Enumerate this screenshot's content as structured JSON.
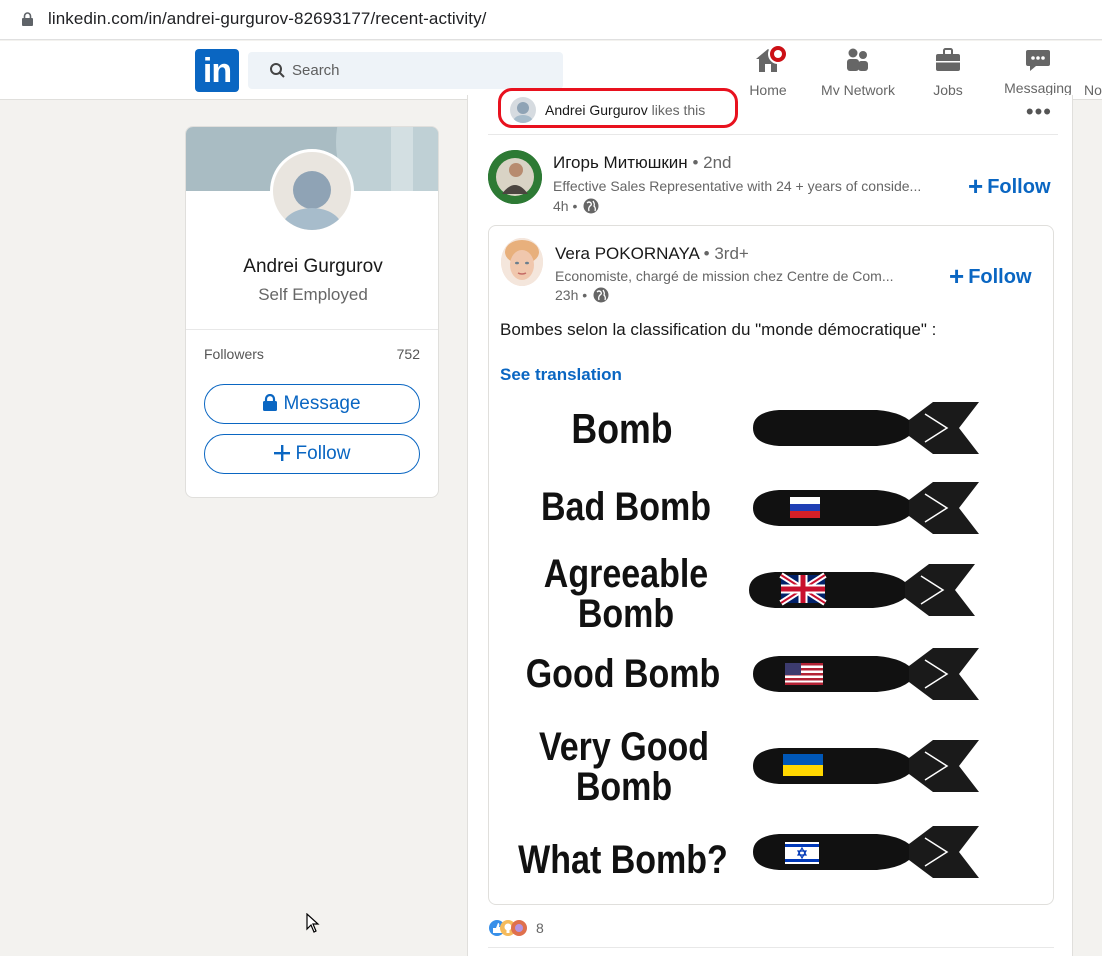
{
  "browser": {
    "url": "linkedin.com/in/andrei-gurgurov-82693177/recent-activity/",
    "icons": [
      "lock-icon"
    ]
  },
  "nav": {
    "logo": "in",
    "search_placeholder": "Search",
    "items": [
      {
        "label": "Home",
        "icon": "home-icon",
        "badge": true
      },
      {
        "label": "My Network",
        "icon": "network-icon"
      },
      {
        "label": "Jobs",
        "icon": "briefcase-icon"
      },
      {
        "label": "Messaging",
        "icon": "messaging-icon"
      },
      {
        "label": "No",
        "icon": "notifications-icon"
      }
    ]
  },
  "profile": {
    "name": "Andrei Gurgurov",
    "title": "Self Employed",
    "followers_label": "Followers",
    "followers_count": "752",
    "message_button": "Message",
    "follow_button": "Follow"
  },
  "feed": {
    "liker_name": "Andrei Gurgurov",
    "liker_suffix": "likes this",
    "more_label": "•••",
    "actor": {
      "name": "Игорь Митюшкин",
      "degree": "• 2nd",
      "headline": "Effective Sales Representative with 24 + years of conside...",
      "time": "4h •",
      "follow": "Follow"
    },
    "shared": {
      "name": "Vera POKORNAYA",
      "degree": "• 3rd+",
      "headline": "Economiste, chargé de mission chez Centre de Com...",
      "time": "23h •",
      "follow": "Follow",
      "text": "Bombes selon la classification du \"monde démocratique\" :",
      "see_translation": "See translation"
    },
    "meme": {
      "rows": [
        {
          "label_line1": "Bomb",
          "label_line2": "",
          "flag": "none"
        },
        {
          "label_line1": "Bad Bomb",
          "label_line2": "",
          "flag": "russia"
        },
        {
          "label_line1": "Agreeable",
          "label_line2": "Bomb",
          "flag": "uk"
        },
        {
          "label_line1": "Good Bomb",
          "label_line2": "",
          "flag": "usa"
        },
        {
          "label_line1": "Very Good",
          "label_line2": "Bomb",
          "flag": "ukraine"
        },
        {
          "label_line1": "What Bomb?",
          "label_line2": "",
          "flag": "israel"
        }
      ]
    },
    "reactions": {
      "count": "8",
      "icons": [
        "like-reaction-icon",
        "insightful-reaction-icon",
        "celebrate-reaction-icon"
      ]
    }
  },
  "colors": {
    "brand": "#0a66c2",
    "highlight": "#e8111e",
    "background": "#f3f2ef"
  }
}
